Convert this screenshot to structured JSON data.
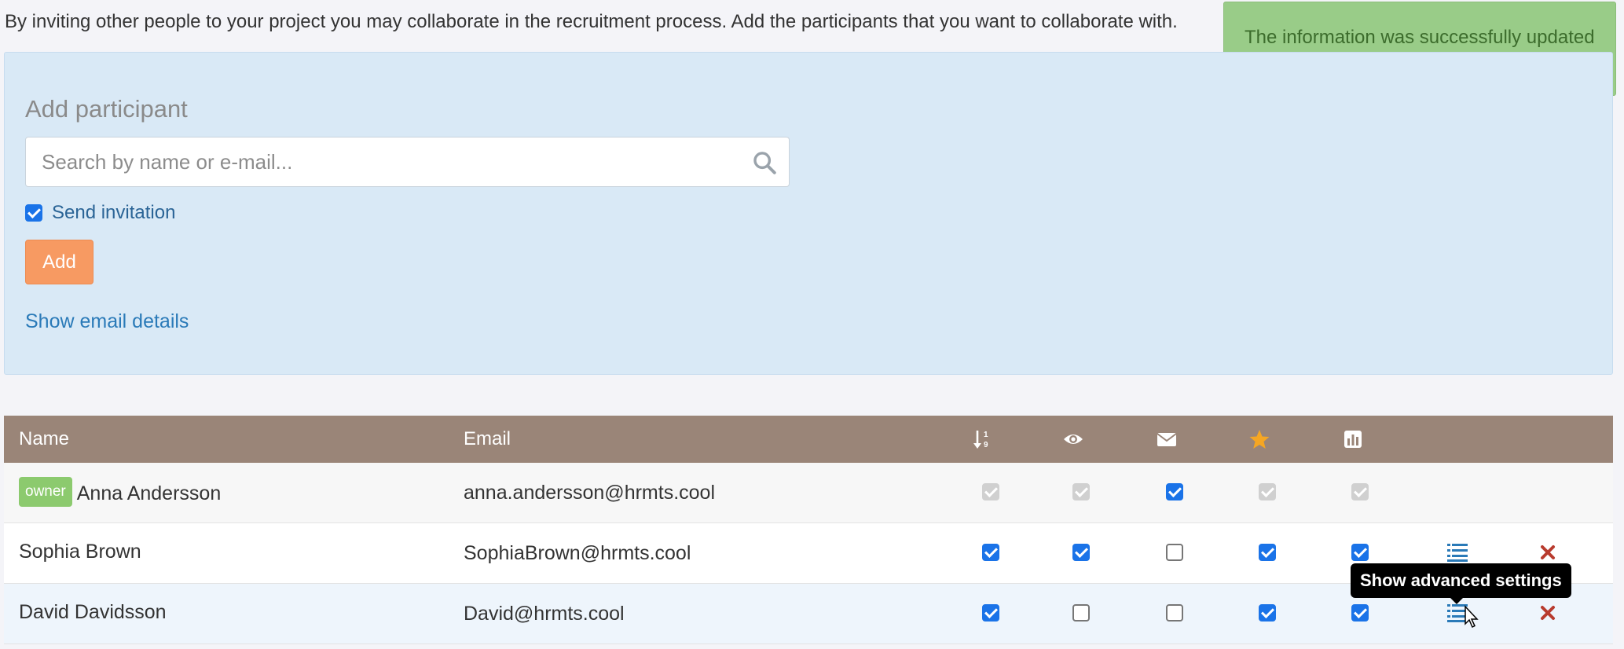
{
  "intro_text": "By inviting other people to your project you may collaborate in the recruitment process. Add the participants that you want to collaborate with.",
  "toast": {
    "message": "The information was successfully updated",
    "color": "#99cc88"
  },
  "add_panel": {
    "title": "Add participant",
    "search_placeholder": "Search by name or e-mail...",
    "search_value": "",
    "send_invitation_label": "Send invitation",
    "send_invitation_checked": true,
    "add_button_label": "Add",
    "email_details_link": "Show email details"
  },
  "table": {
    "header_color": "#9a8578",
    "columns": [
      {
        "label": "Name"
      },
      {
        "label": "Email"
      },
      {
        "icon": "sort-numeric-icon"
      },
      {
        "icon": "eye-icon"
      },
      {
        "icon": "envelope-icon"
      },
      {
        "icon": "star-icon"
      },
      {
        "icon": "bar-chart-icon"
      }
    ],
    "rows": [
      {
        "badge": "owner",
        "name": "Anna Andersson",
        "email": "anna.andersson@hrmts.cool",
        "permissions": [
          "disabled",
          "disabled",
          "checked",
          "disabled",
          "disabled"
        ],
        "editable": false
      },
      {
        "badge": "",
        "name": "Sophia Brown",
        "email": "SophiaBrown@hrmts.cool",
        "permissions": [
          "checked",
          "checked",
          "unchecked",
          "checked",
          "checked"
        ],
        "editable": true
      },
      {
        "badge": "",
        "name": "David Davidsson",
        "email": "David@hrmts.cool",
        "permissions": [
          "checked",
          "unchecked",
          "unchecked",
          "checked",
          "checked"
        ],
        "editable": true
      }
    ]
  },
  "tooltip": {
    "text": "Show advanced settings"
  },
  "colors": {
    "accent": "#1a73e8",
    "add_button": "#f79a62",
    "link": "#2a7ab8",
    "delete": "#b83b2e",
    "star": "#f5a623"
  }
}
